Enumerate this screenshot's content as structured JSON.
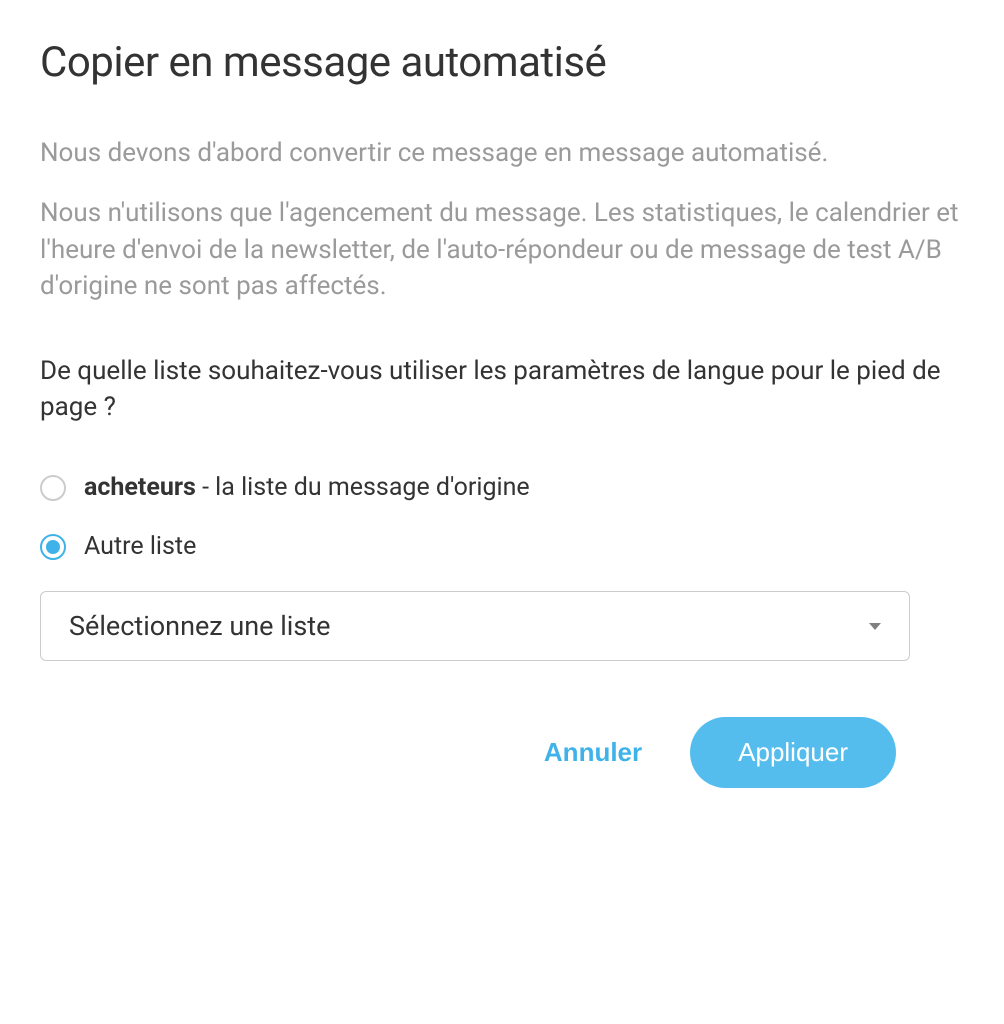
{
  "dialog": {
    "title": "Copier en message automatisé",
    "description_p1": "Nous devons d'abord convertir ce message en message automatisé.",
    "description_p2": "Nous n'utilisons que l'agencement du message. Les statistiques, le calendrier et l'heure d'envoi de la newsletter, de l'auto-répondeur ou de message de test A/B d'origine ne sont pas affectés.",
    "question": "De quelle liste souhaitez-vous utiliser les paramètres de langue pour le pied de page ?",
    "radio_options": [
      {
        "bold": "acheteurs",
        "rest": " - la liste du message d'origine",
        "selected": false
      },
      {
        "bold": "",
        "rest": "Autre liste",
        "selected": true
      }
    ],
    "select_placeholder": "Sélectionnez une liste",
    "cancel_label": "Annuler",
    "apply_label": "Appliquer"
  }
}
